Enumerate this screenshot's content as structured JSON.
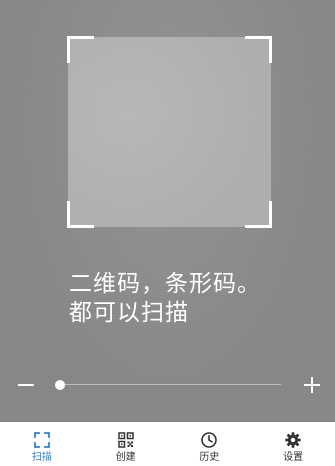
{
  "colors": {
    "accent": "#2f7fd6",
    "tab_text": "#333333",
    "tab_bar_bg": "#ffffff",
    "overlay_text": "#ffffff"
  },
  "scanner": {
    "hint_line1": "二维码，条形码。",
    "hint_line2": "都可以扫描"
  },
  "zoom": {
    "level": 0.0
  },
  "tabs": [
    {
      "label": "扫描",
      "icon": "scan-frame-icon",
      "active": true
    },
    {
      "label": "创建",
      "icon": "qr-code-icon",
      "active": false
    },
    {
      "label": "历史",
      "icon": "clock-icon",
      "active": false
    },
    {
      "label": "设置",
      "icon": "gear-icon",
      "active": false
    }
  ]
}
